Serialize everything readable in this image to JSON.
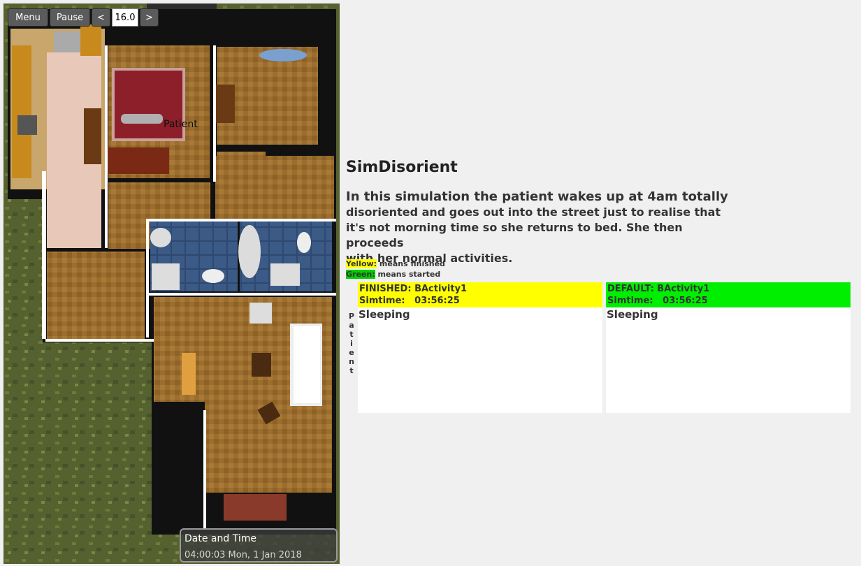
{
  "toolbar": {
    "menu_label": "Menu",
    "pause_label": "Pause",
    "prev_label": "<",
    "speed_value": "16.0",
    "next_label": ">"
  },
  "simulation": {
    "patient_label": "Patient",
    "datetime_title": "Date and Time",
    "datetime_value": "04:00:03 Mon, 1 Jan 2018"
  },
  "info": {
    "title": "SimDisorient",
    "description_lines": [
      "In this simulation the patient wakes up at 4am totally",
      "disoriented and goes out into the street just to realise that",
      "it's not morning time so she returns to bed. She then proceeds",
      "with her normal activities."
    ],
    "legend": {
      "yellow_key": "Yellow:",
      "yellow_text": " means finished",
      "green_key": "Green:",
      "green_text": " means started"
    }
  },
  "activities": {
    "row_label": "Patient",
    "columns": [
      {
        "header": "FINISHED: BActivity1",
        "simtime": "Simtime:   03:56:25",
        "status": "Sleeping",
        "color": "#ffff00"
      },
      {
        "header": "DEFAULT: BActivity1",
        "simtime": "Simtime:   03:56:25",
        "status": "Sleeping",
        "color": "#00ee00"
      }
    ]
  }
}
